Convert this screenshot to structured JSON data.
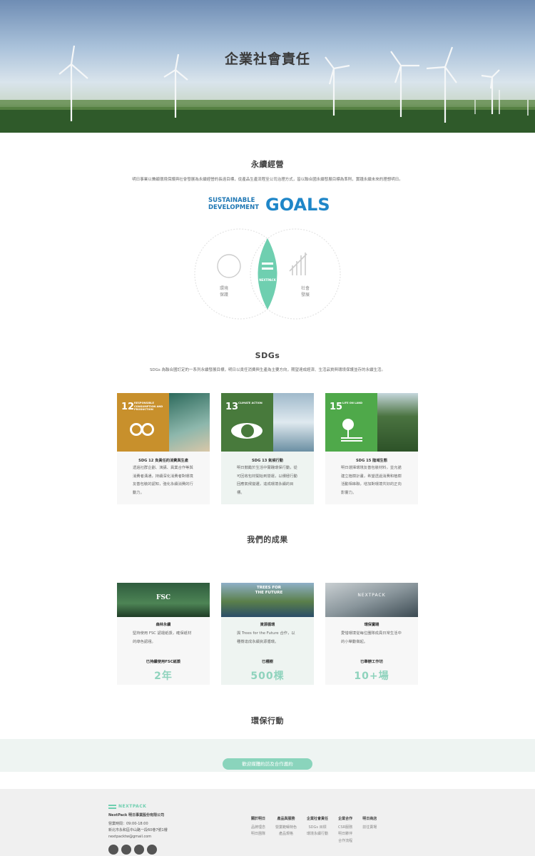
{
  "hero": {
    "title": "企業社會責任"
  },
  "sustain": {
    "title": "永續經營",
    "desc": "明日事業以兼顧環境保護與社會發展為永續經營的長遠目標，從產品生產流程至公司治理方式，皆以聯合國永續發展目標為準則，實踐永續未來的理想明日。",
    "goals_line1": "SUSTAINABLE",
    "goals_line2": "DEVELOPMENT",
    "goals_word": "GOALS",
    "venn_left": [
      "環境",
      "保護"
    ],
    "venn_center": "NEXTPACK",
    "venn_right": [
      "社會",
      "發展"
    ]
  },
  "sdgs": {
    "title": "SDGs",
    "desc": "SDGs 為聯合國訂定的一系列永續發展目標，明日以責任消費與生產為主要方向，期望達成經濟、生活品質與環境保護並存的永續生活。",
    "cards": [
      {
        "num": "12",
        "cap": "Responsible consumption and production",
        "color": "#c8902c",
        "title": "SDG 12 負責任的消費與生產",
        "text": "透過社群企劃、演講、異業合作等與消費者溝通，持續深化消費者對環境友善包裝的認知，強化永續消費的行動力。"
      },
      {
        "num": "13",
        "cap": "Climate action",
        "color": "#487a3c",
        "title": "SDG 13 氣候行動",
        "text": "明日鼓勵於生活中實踐環保行動，從可回收包材開始到營運，以積極行動回應氣候變遷，達成環境永續的目標。"
      },
      {
        "num": "15",
        "cap": "Life on land",
        "color": "#4fa94a",
        "title": "SDG 15 陸域生態",
        "text": "明日選擇環境友善包裝材料，並允諾建立植樹計畫，希望透過消費和植樹活動相串聯，增加對環境共好的正向影響力。"
      }
    ]
  },
  "results": {
    "title": "我們的成果",
    "cards": [
      {
        "img_text": "FSC",
        "title": "森林永續",
        "text": "堅持使用 FSC 認證紙漿，確保紙材的綠色認證。",
        "label": "已持續使用FSC紙漿",
        "value": "2年"
      },
      {
        "img_text": "TREES FOR THE FUTURE",
        "title": "資源循環",
        "text": "與 Trees for the Future 合作，以種樹達成永續資源循環。",
        "label": "已種樹",
        "value": "500棵"
      },
      {
        "img_text": "NEXTPACK",
        "title": "環保實踐",
        "text": "愛惜環境從每位團隊成員日常生活中的小舉動做起。",
        "label": "已舉辦工作坊",
        "value": "10+場"
      }
    ]
  },
  "action": {
    "title": "環保行動",
    "cta": "歡迎媒體約訪及合作邀約"
  },
  "footer": {
    "logo": "NEXTPACK",
    "company": "NextPack 明日事業股份有限公司",
    "hours": "營業時間：09:00-18:00",
    "address": "新北市永和區中山路一段60巷7號1樓",
    "email": "nextpacktw@gmail.com",
    "cols": [
      {
        "h": "關於明日",
        "items": [
          "品牌理念",
          "明日團隊"
        ]
      },
      {
        "h": "產品與服務",
        "items": [
          "營業範疇特色",
          "產品規格"
        ]
      },
      {
        "h": "企業社會責任",
        "items": [
          "SDGs 目標",
          "環境永續行動"
        ]
      },
      {
        "h": "企業合作",
        "items": [
          "CSR服務",
          "明日夥伴",
          "合作流程"
        ]
      },
      {
        "h": "明日商店",
        "items": [
          "前往賣場"
        ]
      }
    ]
  }
}
